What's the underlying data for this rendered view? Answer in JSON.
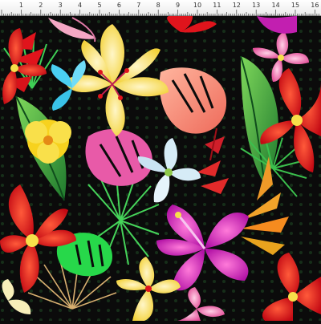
{
  "image": {
    "description": "Tropical floral fabric print on black background with centimeter ruler across the top",
    "background_color": "#0b0b0b",
    "colors": {
      "red": "#e0141c",
      "yellow": "#f7e04a",
      "pink": "#e4398e",
      "magenta": "#c21fb0",
      "white_blue": "#d6ecf7",
      "green": "#2f9e3a",
      "lime": "#27d84a",
      "salmon": "#f07a6a",
      "cream": "#f8efb9"
    }
  },
  "ruler": {
    "unit": "cm",
    "labels": [
      "1",
      "2",
      "3",
      "4",
      "5",
      "6",
      "7",
      "8",
      "9",
      "10",
      "11",
      "12",
      "13",
      "14",
      "15",
      "16"
    ]
  }
}
